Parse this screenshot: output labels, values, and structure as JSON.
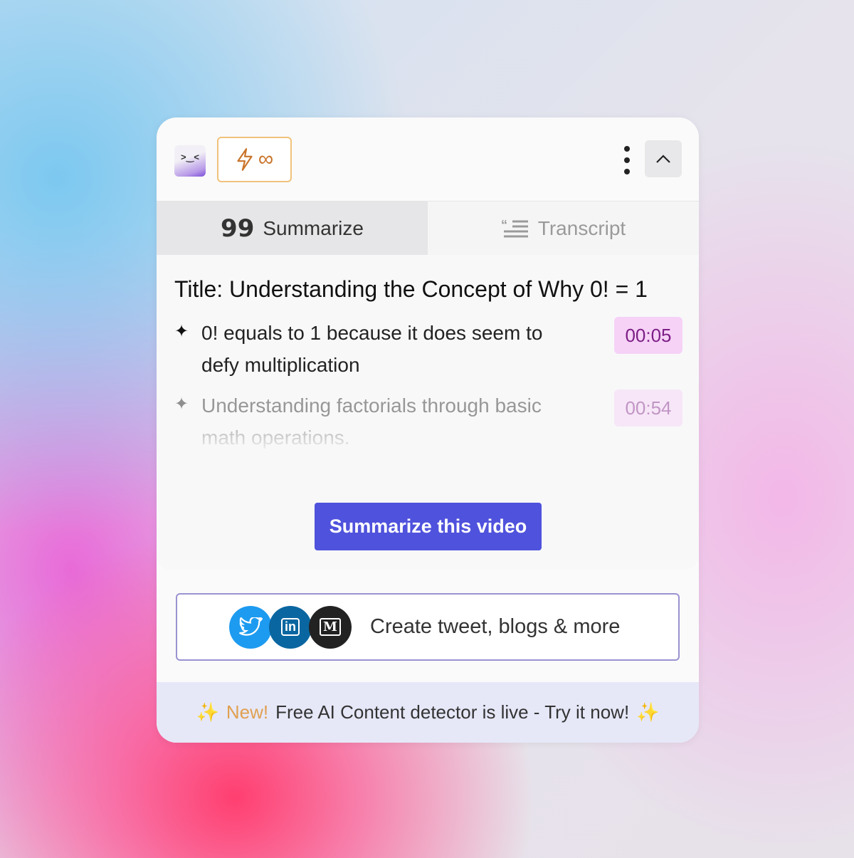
{
  "header": {
    "logo_text": ">‿<",
    "credit_icon": "lightning-icon",
    "credit_value": "∞"
  },
  "tabs": [
    {
      "label": "Summarize",
      "icon": "quote-icon",
      "active": true
    },
    {
      "label": "Transcript",
      "icon": "transcript-icon",
      "active": false
    }
  ],
  "summary": {
    "title": "Title: Understanding the Concept of Why 0! = 1",
    "items": [
      {
        "text": "0! equals to 1 because it does seem to defy multiplication",
        "timestamp": "00:05"
      },
      {
        "text": "Understanding factorials through basic math operations.",
        "timestamp": "00:54"
      }
    ],
    "cta_label": "Summarize this video"
  },
  "share": {
    "label": "Create tweet, blogs & more",
    "icons": [
      "twitter-icon",
      "linkedin-icon",
      "medium-icon"
    ]
  },
  "footer": {
    "badge": "New!",
    "text": "Free AI Content detector is live - Try it now!"
  },
  "colors": {
    "accent": "#4f52dc",
    "timestamp_bg": "#f6d2f7",
    "credit_border": "#f0c27a"
  }
}
